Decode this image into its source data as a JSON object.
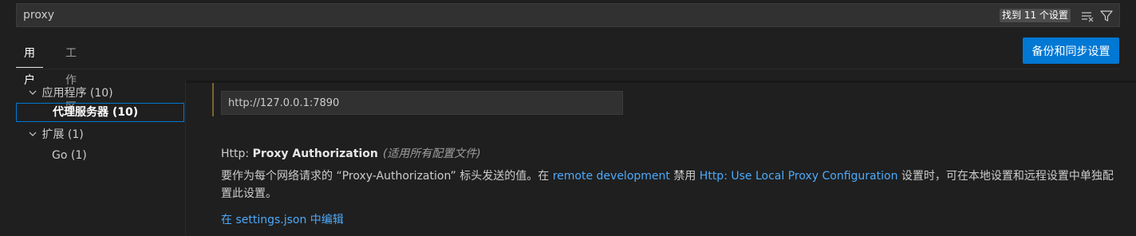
{
  "search": {
    "value": "proxy",
    "result_badge": "找到 11 个设置",
    "clear_icon": "clear-filter-icon",
    "filter_icon": "filter-icon"
  },
  "tabs": [
    {
      "label": "用户",
      "active": true
    },
    {
      "label": "工作区",
      "active": false
    }
  ],
  "sync_button": "备份和同步设置",
  "toc": {
    "items": [
      {
        "label": "应用程序 (10)",
        "expanded": true
      },
      {
        "label": "代理服务器 (10)",
        "selected": true
      },
      {
        "label": "扩展 (1)",
        "expanded": true
      },
      {
        "label": "Go (1)"
      }
    ]
  },
  "setting_value": {
    "value": "http://127.0.0.1:7890"
  },
  "setting": {
    "category": "Http: ",
    "name": "Proxy Authorization",
    "scope": "(适用所有配置文件)",
    "desc_part1": "要作为每个网络请求的 “Proxy-Authorization” 标头发送的值。在 ",
    "desc_link1": "remote development",
    "desc_part2": " 禁用 ",
    "desc_link2": "Http: Use Local Proxy Configuration",
    "desc_part3": " 设置时，可在本地设置和远程设置中单独配置此设置。",
    "edit_link": "在 settings.json 中编辑"
  },
  "colors": {
    "accent": "#0078d4",
    "link": "#4daafc",
    "modified_indicator": "#7a6632"
  }
}
